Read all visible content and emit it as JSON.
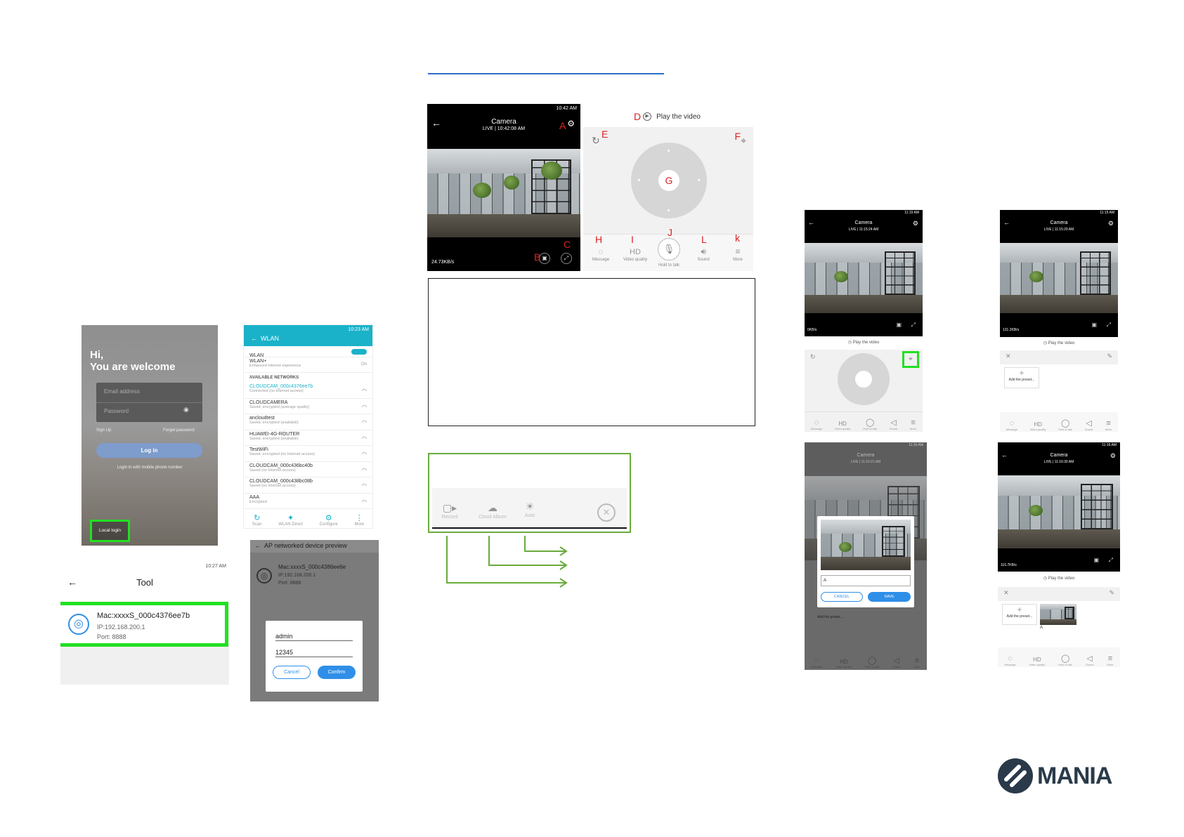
{
  "login": {
    "greeting": "Hi,",
    "welcome": "You are welcome",
    "email_placeholder": "Email address",
    "password_placeholder": "Password",
    "sign_up": "Sign Up",
    "forget_password": "Forget password",
    "login_button": "Log in",
    "mobile_login": "Login in with mobile phone number",
    "local_login": "Local login"
  },
  "wlan": {
    "status_time": "10:23 AM",
    "title": "WLAN",
    "wlan_label": "WLAN",
    "wlan_plus": "WLAN+",
    "wlan_plus_sub": "Enhanced Internet experience",
    "wlan_plus_value": "On",
    "section": "AVAILABLE NETWORKS",
    "networks": [
      {
        "name": "CLOUDCAM_000c4376ee7b",
        "status": "Connected (no Internet access)"
      },
      {
        "name": "CLOUDCAMERA",
        "status": "Saved, encrypted (average quality)"
      },
      {
        "name": "ancloudtest",
        "status": "Saved, encrypted (available)"
      },
      {
        "name": "HUAWEI-4G-ROUTER",
        "status": "Saved, encrypted (available)"
      },
      {
        "name": "TestWiFi",
        "status": "Saved, encrypted (no Internet access)"
      },
      {
        "name": "CLOUDCAM_000c436bc40b",
        "status": "Saved (no Internet access)"
      },
      {
        "name": "CLOUDCAM_000c438bc08b",
        "status": "Saved (no Internet access)"
      },
      {
        "name": "AAA",
        "status": "Encrypted"
      }
    ],
    "bottom": [
      "Scan",
      "WLAN Direct",
      "Configure",
      "More"
    ]
  },
  "tool": {
    "status_time": "10:27 AM",
    "title": "Tool",
    "mac": "Mac:xxxxS_000c4376ee7b",
    "ip": "IP:192.168.200.1",
    "port": "Port: 8888"
  },
  "ap": {
    "title": "AP networked device preview",
    "mac": "Mac:xxxxS_000c4386ee6e",
    "ip": "IP:192.168.200.1",
    "port": "Port: 8888",
    "user": "admin",
    "pass": "12345",
    "cancel": "Cancel",
    "confirm": "Confirm"
  },
  "camera": {
    "status_time": "10:42 AM",
    "title": "Camera",
    "live": "LIVE | 10:42:08 AM",
    "bitrate": "24.73KB/s",
    "play_video": "Play the video",
    "labels": {
      "A": "A",
      "B": "B",
      "C": "C",
      "D": "D",
      "E": "E",
      "F": "F",
      "G": "G",
      "H": "H",
      "I": "I",
      "J": "J",
      "L": "L",
      "K": "k"
    },
    "toolbar": [
      "Message",
      "Video quality",
      "Hold to talk",
      "Sound",
      "More"
    ],
    "hd": "HD"
  },
  "record_bar": [
    "Record",
    "Cloud Album",
    "Auto"
  ],
  "thumbs": {
    "t1": {
      "status": "11:15 AM",
      "title": "Camera",
      "live": "LIVE | 11:15:24 AM",
      "bitrate": "0KB/s",
      "play": "Play the video"
    },
    "t2": {
      "status": "11:15 AM",
      "title": "Camera",
      "live": "LIVE | 11:15:29 AM",
      "bitrate": "131.2KB/s",
      "play": "Play the video",
      "add": "Add the preset..."
    },
    "t3": {
      "status": "11:16 AM",
      "title": "Camera",
      "live": "LIVE | 11:16:21 AM",
      "input": "A",
      "cancel": "CANCEL",
      "save": "SAVE",
      "add": "Add the preset..."
    },
    "t4": {
      "status": "11:16 AM",
      "title": "Camera",
      "live": "LIVE | 11:16:30 AM",
      "bitrate": "116.7KB/s",
      "play": "Play the video",
      "add": "Add the preset...",
      "preset": "A"
    },
    "toolbar": [
      "Message",
      "Video quality",
      "Hold to talk",
      "Sound",
      "More"
    ],
    "hd": "HD"
  },
  "brand": {
    "name": "MANIA",
    "color": "#2a3a4a"
  },
  "colors": {
    "highlight": "#22e022",
    "accent": "#2f8fe8",
    "wlan_bar": "#1ab2c9",
    "red_label": "#d22222",
    "green_arrow": "#6aab3c"
  }
}
